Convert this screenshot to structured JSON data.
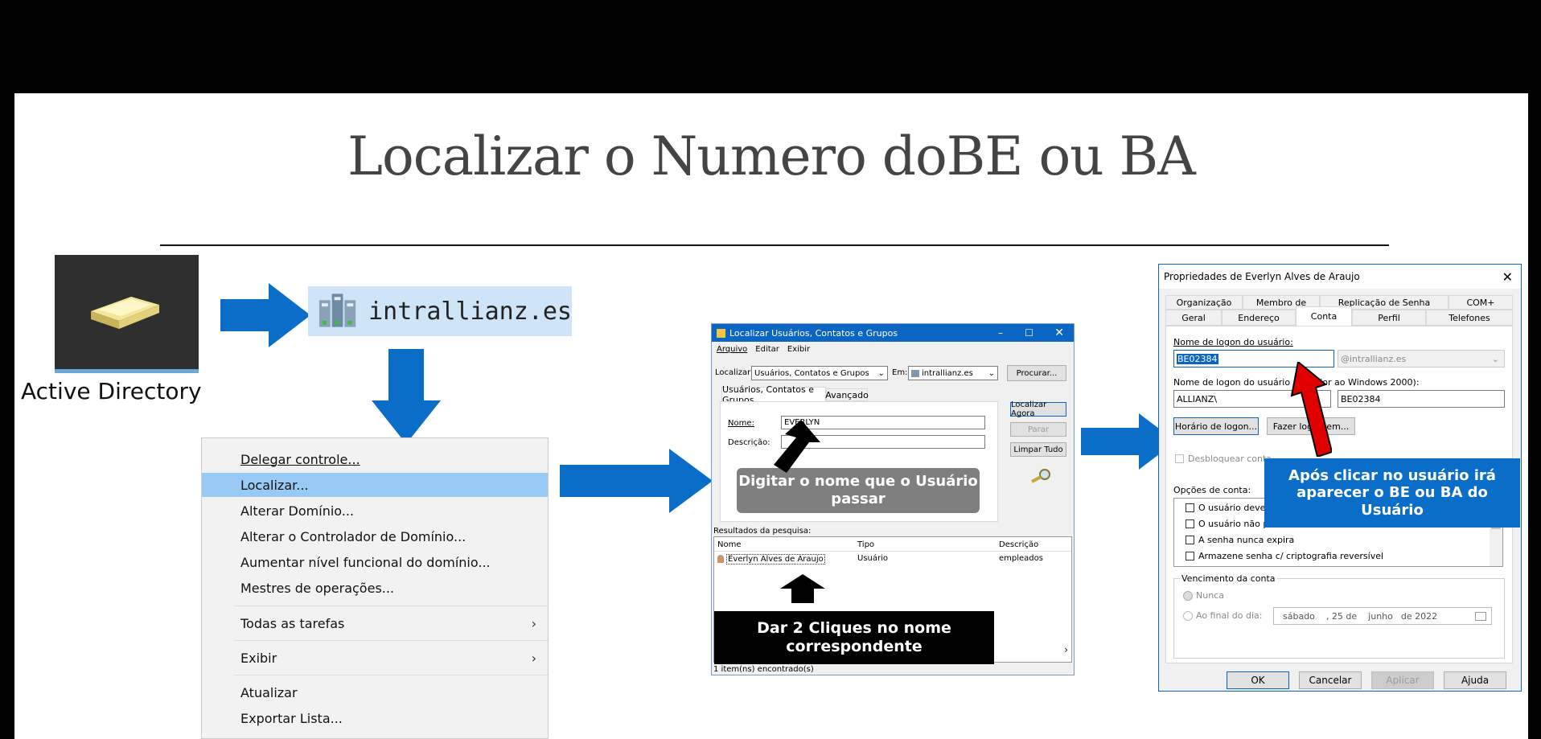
{
  "slide": {
    "title": "Localizar o Numero doBE ou BA"
  },
  "ad_icon": {
    "label": "Active Directory"
  },
  "domain_chip": {
    "label": "intrallianz.es"
  },
  "context_menu": {
    "items": [
      {
        "label": "Delegar controle..."
      },
      {
        "label": "Localizar..."
      },
      {
        "label": "Alterar Domínio..."
      },
      {
        "label": "Alterar o Controlador de Domínio..."
      },
      {
        "label": "Aumentar nível funcional do domínio..."
      },
      {
        "label": "Mestres de operações..."
      },
      {
        "label": "Todas as tarefas"
      },
      {
        "label": "Exibir"
      },
      {
        "label": "Atualizar"
      },
      {
        "label": "Exportar Lista..."
      }
    ]
  },
  "find_dialog": {
    "title": "Localizar Usuários, Contatos e Grupos",
    "menu": [
      "Arquivo",
      "Editar",
      "Exibir"
    ],
    "find_label": "Localizar:",
    "find_value": "Usuários, Contatos e Grupos",
    "in_label": "Em:",
    "in_value": "intrallianz.es",
    "browse_button": "Procurar...",
    "tabs": [
      "Usuários, Contatos e Grupos",
      "Avançado"
    ],
    "name_label": "Nome:",
    "name_value": "EVERLYN",
    "description_label": "Descrição:",
    "find_now_button": "Localizar Agora",
    "stop_button": "Parar",
    "clear_button": "Limpar Tudo",
    "results_label": "Resultados da pesquisa:",
    "columns": [
      "Nome",
      "Tipo",
      "Descrição"
    ],
    "rows": [
      {
        "name": "Everlyn Alves de Araujo",
        "type": "Usuário",
        "description": "empleados"
      }
    ],
    "status": "1 item(ns) encontrado(s)"
  },
  "callouts": {
    "type_name": "Digitar o nome que o Usuário passar",
    "double_click": "Dar 2 Cliques no nome correspondente",
    "after_click": "Após clicar no usuário irá aparecer o BE ou BA do Usuário"
  },
  "props_dialog": {
    "title": "Propriedades de Everlyn Alves de Araujo",
    "tabs_row1": [
      "Organização",
      "Membro de",
      "Replicação de Senha",
      "COM+"
    ],
    "tabs_row2": [
      "Geral",
      "Endereço",
      "Conta",
      "Perfil",
      "Telefones"
    ],
    "logon_label": "Nome de logon do usuário:",
    "logon_value": "BE02384",
    "upn_suffix": "@intrallianz.es",
    "pre2000_label": "Nome de logon do usuário (anterior ao Windows 2000):",
    "domain_prefix": "ALLIANZ\\",
    "pre2000_value": "BE02384",
    "logon_hours_button": "Horário de logon...",
    "logon_to_button": "Fazer logon em...",
    "unlock_label": "Desbloquear conta",
    "options_label": "Opções de conta:",
    "options": [
      "O usuário deve alterar a senha no próximo logon",
      "O usuário não pode alterar a senha",
      "A senha nunca expira",
      "Armazene senha c/ criptografia reversível"
    ],
    "expiry_label": "Vencimento da conta",
    "never_label": "Nunca",
    "end_of_label": "Ao final do dia:",
    "date_weekday": "sábado",
    "date_day": ", 25 de",
    "date_month": "junho",
    "date_year": "de 2022",
    "ok": "OK",
    "cancel": "Cancelar",
    "apply": "Aplicar",
    "help": "Ajuda"
  },
  "colors": {
    "arrow_blue": "#0a6ec9",
    "callout_grey": "#7f7f7f",
    "callout_black": "#000000",
    "callout_blue": "#0a6ec9",
    "red_arrow": "#e00000",
    "highlight": "#99c9f5"
  }
}
